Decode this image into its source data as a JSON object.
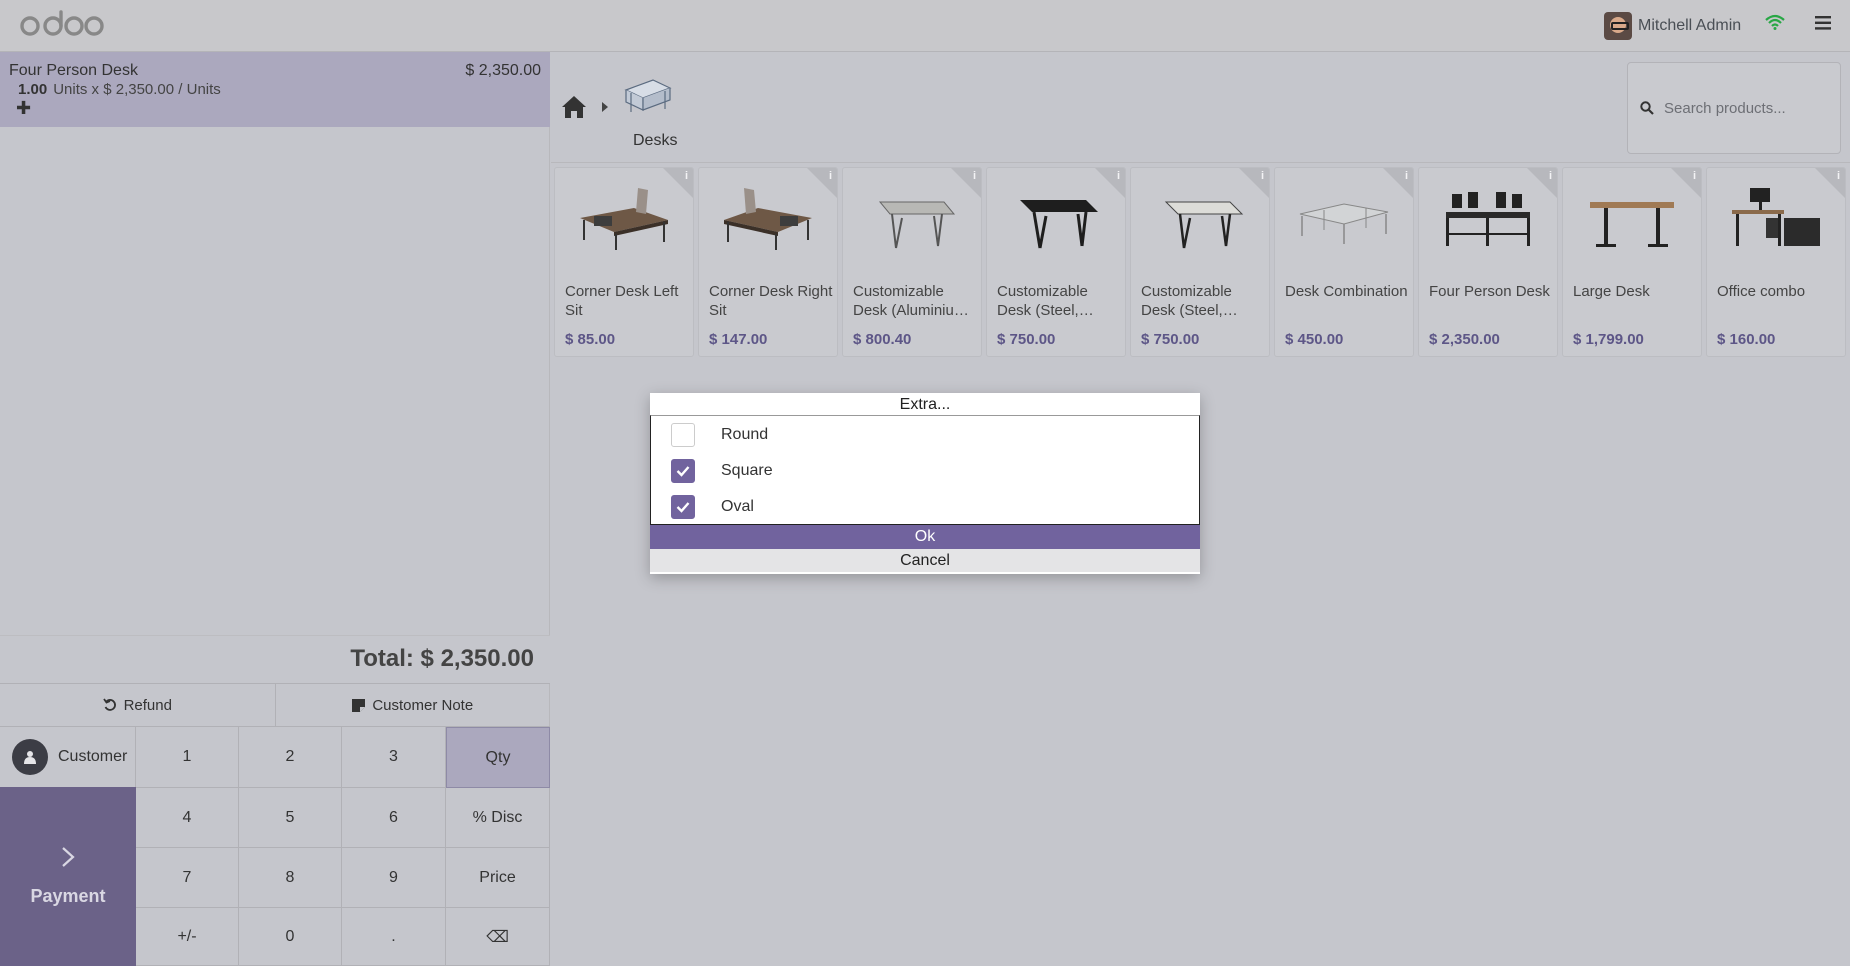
{
  "topbar": {
    "user_name": "Mitchell Admin"
  },
  "order": {
    "line": {
      "name": "Four Person Desk",
      "price": "$ 2,350.00",
      "qty": "1.00",
      "detail": "Units x $ 2,350.00 / Units"
    },
    "total": "Total: $ 2,350.00"
  },
  "controls": {
    "refund": "Refund",
    "customer_note": "Customer Note",
    "customer": "Customer",
    "payment": "Payment"
  },
  "numpad": [
    "1",
    "2",
    "3",
    "Qty",
    "4",
    "5",
    "6",
    "% Disc",
    "7",
    "8",
    "9",
    "Price",
    "+/-",
    "0",
    ".",
    "⌫"
  ],
  "breadcrumb": {
    "category": "Desks"
  },
  "search": {
    "placeholder": "Search products..."
  },
  "products": [
    {
      "name": "Corner Desk Left Sit",
      "price": "$ 85.00",
      "icon": "corner-desk-left-sit-image"
    },
    {
      "name": "Corner Desk Right Sit",
      "price": "$ 147.00",
      "icon": "corner-desk-right-sit-image"
    },
    {
      "name": "Customizable Desk (Aluminiu…",
      "price": "$ 800.40",
      "icon": "customizable-desk-aluminium-image"
    },
    {
      "name": "Customizable Desk (Steel,…",
      "price": "$ 750.00",
      "icon": "customizable-desk-steel-black-image"
    },
    {
      "name": "Customizable Desk (Steel,…",
      "price": "$ 750.00",
      "icon": "customizable-desk-steel-white-image"
    },
    {
      "name": "Desk Combination",
      "price": "$ 450.00",
      "icon": "desk-combination-image"
    },
    {
      "name": "Four Person Desk",
      "price": "$ 2,350.00",
      "icon": "four-person-desk-image"
    },
    {
      "name": "Large Desk",
      "price": "$ 1,799.00",
      "icon": "large-desk-image"
    },
    {
      "name": "Office combo",
      "price": "$ 160.00",
      "icon": "office-combo-image"
    }
  ],
  "modal": {
    "title": "Extra...",
    "options": [
      {
        "label": "Round",
        "checked": false
      },
      {
        "label": "Square",
        "checked": true
      },
      {
        "label": "Oval",
        "checked": true
      }
    ],
    "ok": "Ok",
    "cancel": "Cancel"
  },
  "colors": {
    "accent": "#71639e",
    "price": "#5d5687",
    "wifi": "#28a745"
  }
}
